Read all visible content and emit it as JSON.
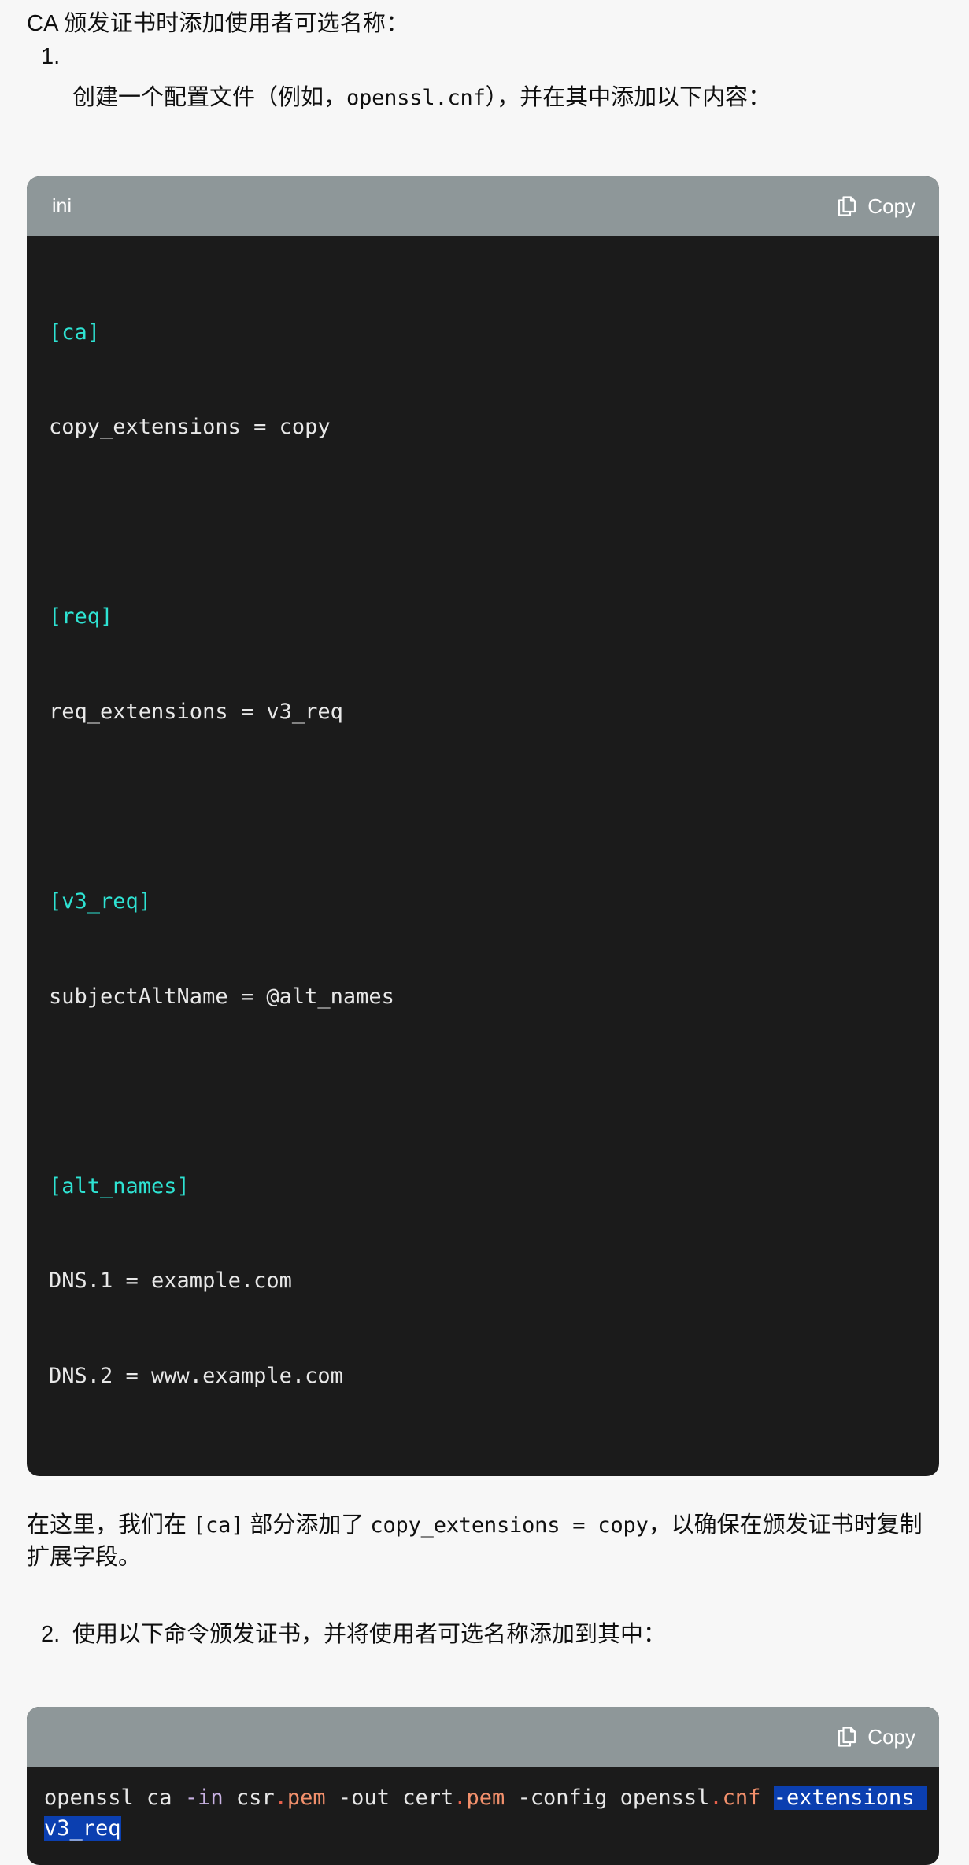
{
  "document": {
    "lead_paragraph": "CA 颁发证书时添加使用者可选名称：",
    "steps": [
      {
        "number": "1.",
        "text_before_code": "创建一个配置文件（例如，",
        "inline_code": "openssl.cnf",
        "text_after_code": "），并在其中添加以下内容："
      },
      {
        "number": "2.",
        "text": "使用以下命令颁发证书，并将使用者可选名称添加到其中："
      }
    ],
    "middle_paragraph": {
      "part1": "在这里，我们在 ",
      "code1": "[ca]",
      "part2": " 部分添加了 ",
      "code2": "copy_extensions = copy",
      "part3": "，以确保在颁发证书时复制扩展字段。"
    }
  },
  "code_block_ini": {
    "language_label": "ini",
    "copy_label": "Copy",
    "copy_icon": "copy-documents-icon",
    "lines": [
      {
        "type": "section",
        "text": "[ca]"
      },
      {
        "type": "plain",
        "text": "copy_extensions = copy"
      },
      {
        "type": "blank",
        "text": ""
      },
      {
        "type": "section",
        "text": "[req]"
      },
      {
        "type": "plain",
        "text": "req_extensions = v3_req"
      },
      {
        "type": "blank",
        "text": ""
      },
      {
        "type": "section",
        "text": "[v3_req]"
      },
      {
        "type": "plain",
        "text": "subjectAltName = @alt_names"
      },
      {
        "type": "blank",
        "text": ""
      },
      {
        "type": "section",
        "text": "[alt_names]"
      },
      {
        "type": "plain",
        "text": "DNS.1 = example.com"
      },
      {
        "type": "plain",
        "text": "DNS.2 = www.example.com"
      }
    ],
    "plain_text": "[ca]\ncopy_extensions = copy\n\n[req]\nreq_extensions = v3_req\n\n[v3_req]\nsubjectAltName = @alt_names\n\n[alt_names]\nDNS.1 = example.com\nDNS.2 = www.example.com"
  },
  "code_block_command": {
    "language_label": "",
    "copy_label": "Copy",
    "copy_icon": "copy-documents-icon",
    "tokens": {
      "t1": "openssl ca ",
      "t2": "-in",
      "t3": " csr",
      "t4": ".",
      "t5": "pem",
      "t6": " -out cert",
      "t7": ".",
      "t8": "pem",
      "t9": " -config openssl",
      "t10": ".",
      "t11": "cnf",
      "t12": " ",
      "selected": "-extensions v3_req"
    },
    "plain_text": "openssl ca -in csr.pem -out cert.pem -config openssl.cnf -extensions v3_req",
    "selection_color": "#0b3fb0"
  },
  "theme": {
    "page_background": "#f7f7f7",
    "code_background": "#1b1b1b",
    "code_header_background": "#8e9799",
    "section_token_color": "#2ee3d3",
    "plain_token_color": "#e8e8e8",
    "option_token_color": "#c9b2e3",
    "extension_token_color": "#f2906c",
    "dot_token_color": "#e8604b",
    "text_color": "#0f0f0f"
  }
}
